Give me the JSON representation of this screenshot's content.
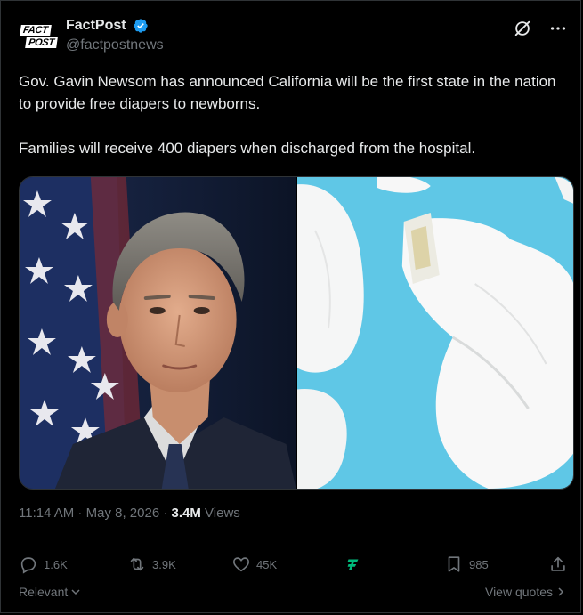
{
  "author": {
    "logo_line1": "FACT",
    "logo_line2": "POST",
    "display_name": "FactPost",
    "handle": "@factpostnews"
  },
  "icons": {
    "verified": "verified-badge-icon",
    "grok": "grok-icon",
    "more": "more-icon",
    "reply": "reply-icon",
    "repost": "repost-icon",
    "like": "like-icon",
    "grok_promo": "grok-analytics-icon",
    "bookmark": "bookmark-icon",
    "share": "share-icon"
  },
  "tweet": {
    "paragraph1": "Gov. Gavin Newsom has announced California will be the first state in the nation to provide free diapers to newborns.",
    "paragraph2": "Families will receive 400 diapers when discharged from the hospital."
  },
  "meta": {
    "time": "11:14 AM",
    "separator1": " · ",
    "date": "May 8, 2026",
    "separator2": " · ",
    "views_count": "3.4M",
    "views_label": " Views"
  },
  "actions": {
    "replies": "1.6K",
    "reposts": "3.9K",
    "likes": "45K",
    "bookmarks": "985"
  },
  "footer": {
    "sort_label": "Relevant",
    "view_quotes": "View quotes"
  },
  "colors": {
    "background": "#000000",
    "text_primary": "#e7e9ea",
    "text_secondary": "#71767b",
    "verified": "#1d9bf0",
    "grok_green": "#00ba7c",
    "border": "#2f3336"
  }
}
